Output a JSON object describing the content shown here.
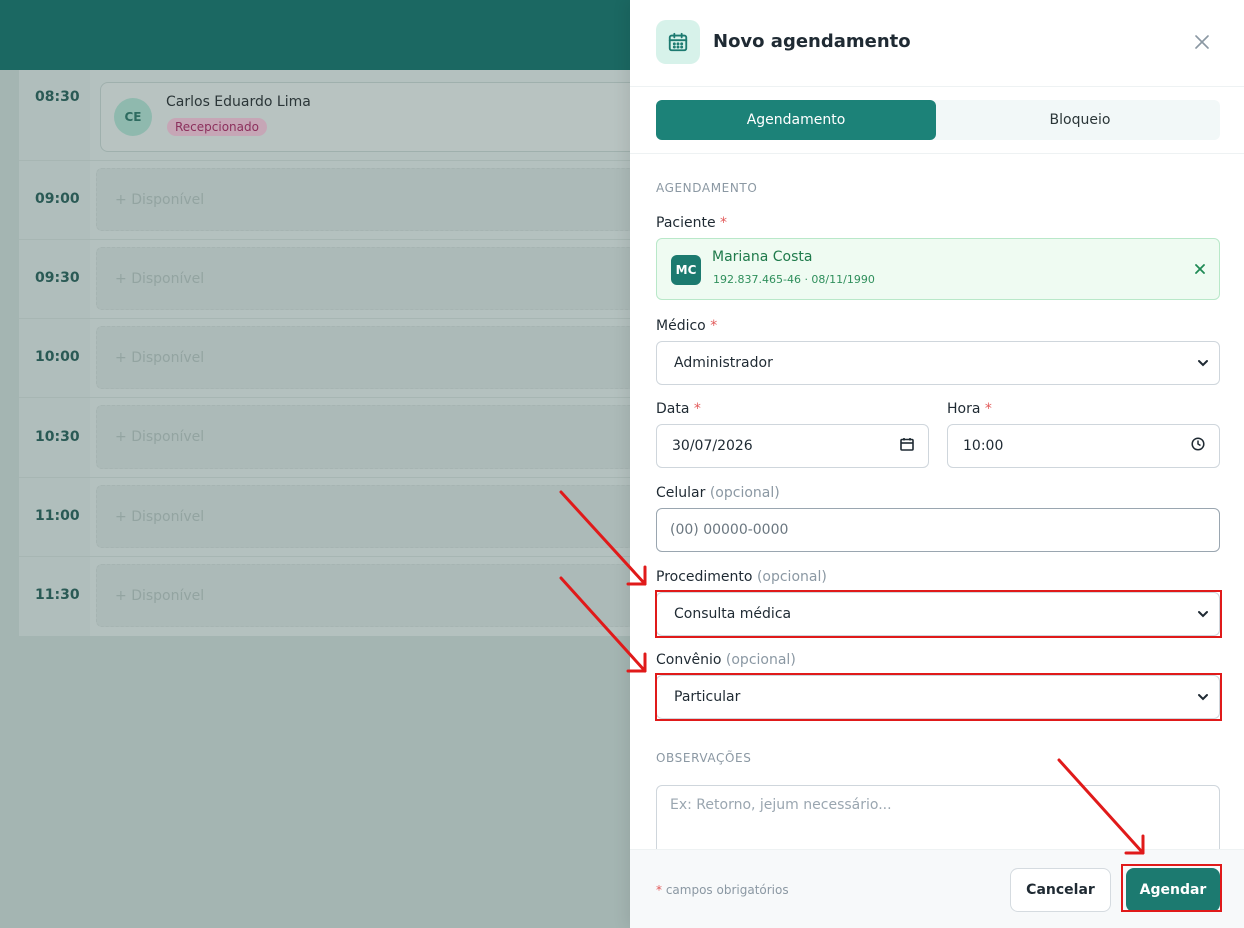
{
  "schedule": {
    "appointment": {
      "time": "08:30",
      "initials": "CE",
      "patient_name": "Carlos Eduardo Lima",
      "status": "Recepcionado"
    },
    "slots": [
      {
        "time": "09:00",
        "label": "Disponível"
      },
      {
        "time": "09:30",
        "label": "Disponível"
      },
      {
        "time": "10:00",
        "label": "Disponível"
      },
      {
        "time": "10:30",
        "label": "Disponível"
      },
      {
        "time": "11:00",
        "label": "Disponível"
      },
      {
        "time": "11:30",
        "label": "Disponível"
      }
    ]
  },
  "drawer": {
    "title": "Novo agendamento",
    "tabs": [
      {
        "label": "Agendamento",
        "active": true
      },
      {
        "label": "Bloqueio",
        "active": false
      }
    ],
    "section_agendamento": "AGENDAMENTO",
    "paciente": {
      "label": "Paciente",
      "initials": "MC",
      "name": "Mariana Costa",
      "meta": "192.837.465-46 · 08/11/1990"
    },
    "medico": {
      "label": "Médico",
      "value": "Administrador"
    },
    "data": {
      "label": "Data",
      "value": "30/07/2026"
    },
    "hora": {
      "label": "Hora",
      "value": "10:00"
    },
    "celular": {
      "label": "Celular",
      "optional": "(opcional)",
      "placeholder": "(00) 00000-0000"
    },
    "procedimento": {
      "label": "Procedimento",
      "optional": "(opcional)",
      "value": "Consulta médica"
    },
    "convenio": {
      "label": "Convênio",
      "optional": "(opcional)",
      "value": "Particular"
    },
    "section_observacoes": "OBSERVAÇÕES",
    "observacoes_placeholder": "Ex: Retorno, jejum necessário...",
    "required_mark": "*",
    "footer": {
      "footnote": "campos obrigatórios",
      "cancel_label": "Cancelar",
      "submit_label": "Agendar"
    }
  },
  "colors": {
    "primary": "#1c8278",
    "annotation": "#e01a1a",
    "required": "#e25a5a"
  },
  "icons": [
    "calendar-icon",
    "close-icon",
    "remove-patient-icon",
    "chevron-down-icon",
    "calendar-picker-icon",
    "clock-icon",
    "plus-icon"
  ]
}
